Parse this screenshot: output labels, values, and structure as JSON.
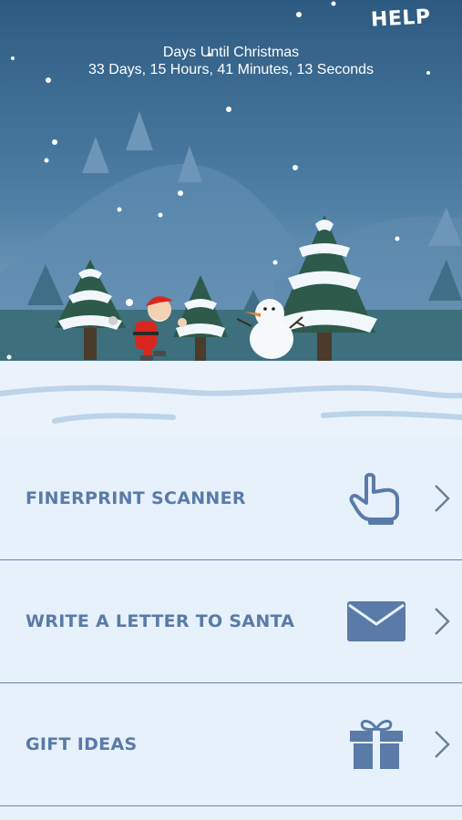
{
  "header": {
    "help_label": "HELP",
    "countdown_title": "Days Until Christmas",
    "countdown_value": "33 Days, 15 Hours, 41 Minutes, 13 Seconds"
  },
  "menu": {
    "items": [
      {
        "label": "FINERPRINT SCANNER",
        "icon": "pointing-hand-icon"
      },
      {
        "label": "WRITE A LETTER TO SANTA",
        "icon": "envelope-icon"
      },
      {
        "label": "GIFT IDEAS",
        "icon": "gift-box-icon"
      }
    ]
  },
  "colors": {
    "sky_top": "#2e5c82",
    "sky_bottom": "#7aa0c0",
    "menu_text": "#5a7ba8",
    "menu_bg": "#e6f1fb",
    "divider": "#6a84a6"
  }
}
